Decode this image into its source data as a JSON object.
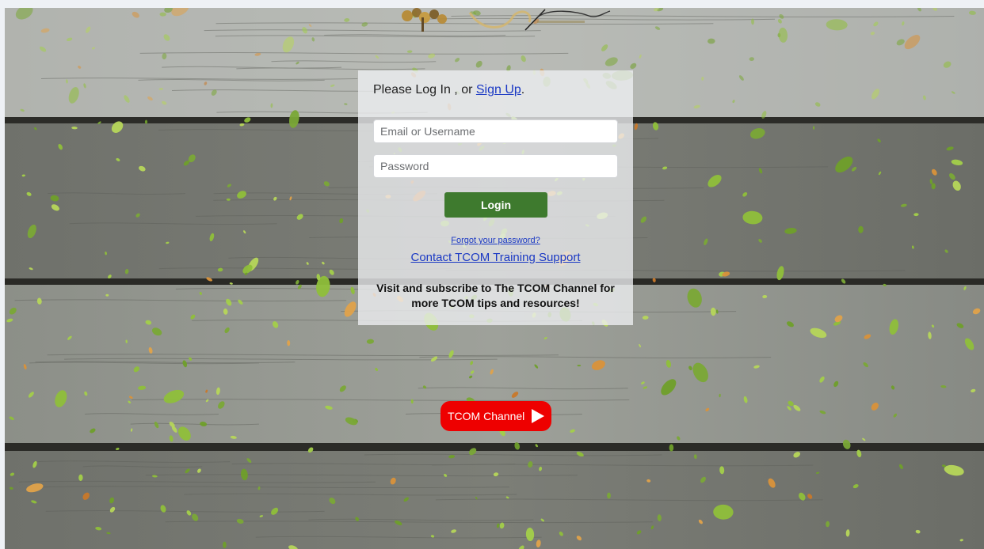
{
  "login": {
    "prompt_text": "Please Log In , or ",
    "signup_link": "Sign Up",
    "prompt_end": ".",
    "username_placeholder": "Email or Username",
    "password_placeholder": "Password",
    "login_button": "Login",
    "forgot_link": "Forgot your password?",
    "support_link": "Contact TCOM Training Support",
    "subscribe_text": "Visit and subscribe to The TCOM Channel for more TCOM tips and resources!"
  },
  "channel_button": {
    "label": "TCOM Channel",
    "icon": "play-icon",
    "color": "#ee0000"
  },
  "colors": {
    "login_button": "#3e7a2e",
    "link": "#1b39c4"
  }
}
